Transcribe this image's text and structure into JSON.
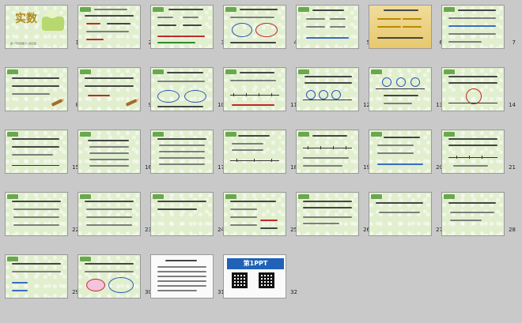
{
  "window": {
    "view": "slide-sorter"
  },
  "cover": {
    "title": "实数",
    "author": "第一节对应数十二级五班"
  },
  "brand": {
    "logo_text": "第1PPT"
  },
  "slides": [
    {
      "num": "1"
    },
    {
      "num": "2"
    },
    {
      "num": "3"
    },
    {
      "num": "4"
    },
    {
      "num": "5"
    },
    {
      "num": "6"
    },
    {
      "num": "7"
    },
    {
      "num": "8"
    },
    {
      "num": "9"
    },
    {
      "num": "10"
    },
    {
      "num": "11"
    },
    {
      "num": "12"
    },
    {
      "num": "13"
    },
    {
      "num": "14"
    },
    {
      "num": "15"
    },
    {
      "num": "16"
    },
    {
      "num": "17"
    },
    {
      "num": "18"
    },
    {
      "num": "19"
    },
    {
      "num": "20"
    },
    {
      "num": "21"
    },
    {
      "num": "22"
    },
    {
      "num": "23"
    },
    {
      "num": "24"
    },
    {
      "num": "25"
    },
    {
      "num": "26"
    },
    {
      "num": "27"
    },
    {
      "num": "28"
    },
    {
      "num": "29"
    },
    {
      "num": "30"
    },
    {
      "num": "31"
    },
    {
      "num": "32"
    }
  ]
}
